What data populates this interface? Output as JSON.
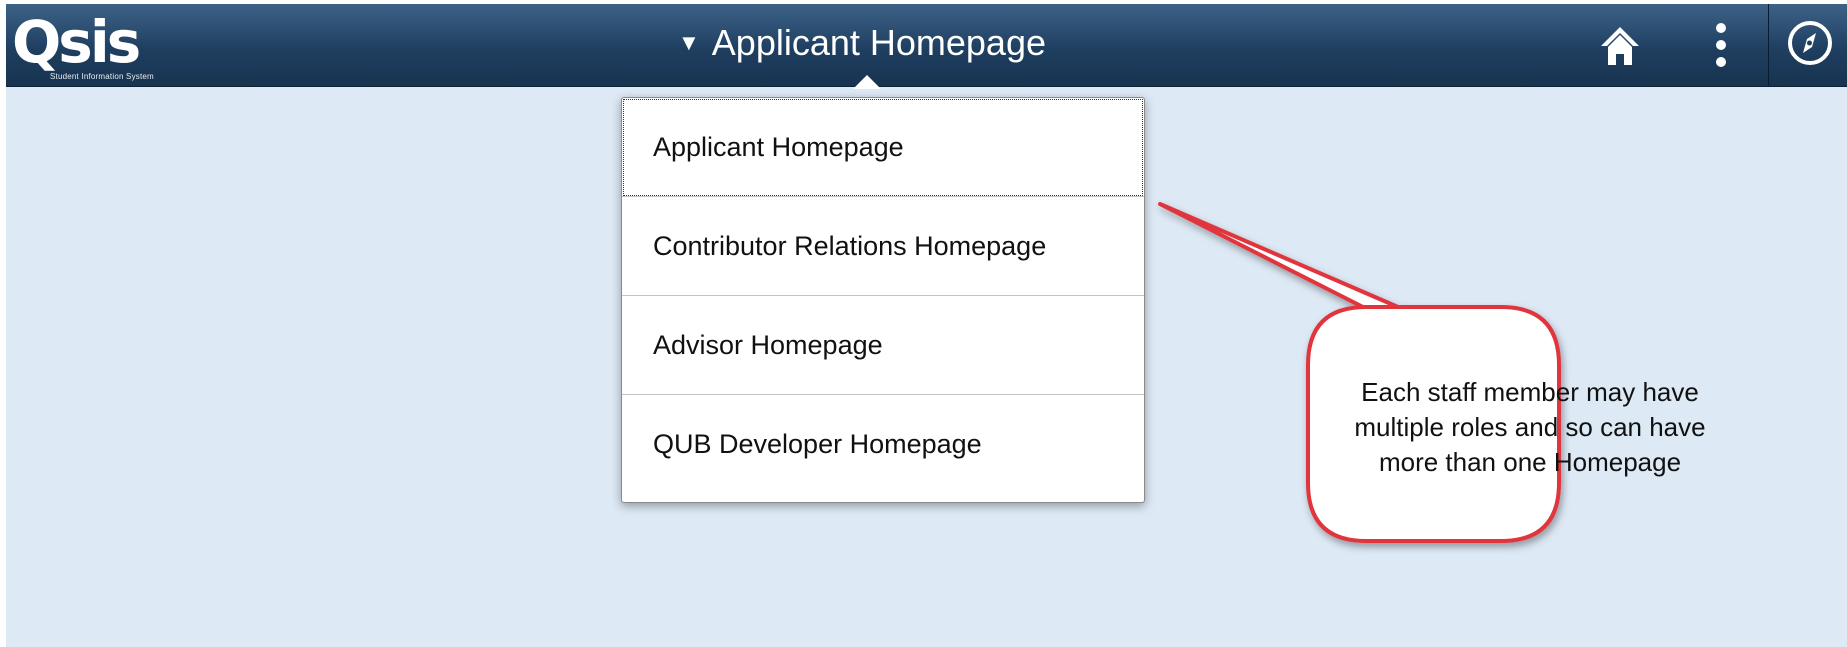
{
  "banner": {
    "logo_text": "Qsis",
    "logo_subtext": "Student Information System",
    "title": "Applicant Homepage",
    "title_arrow": "▼"
  },
  "icons": {
    "home": "home-icon",
    "actions": "actions-list-icon",
    "navbar": "navbar-compass-icon"
  },
  "homepage_menu": {
    "items": [
      {
        "label": "Applicant Homepage",
        "focused": true
      },
      {
        "label": "Contributor Relations Homepage",
        "focused": false
      },
      {
        "label": "Advisor Homepage",
        "focused": false
      },
      {
        "label": "QUB Developer Homepage",
        "focused": false
      }
    ]
  },
  "callout": {
    "text_lines": [
      "Each staff member may have",
      "multiple roles and so can have",
      "more than one Homepage"
    ]
  },
  "colors": {
    "banner": "#1f3f61",
    "background": "#dde9f5",
    "callout_border": "#e0343c"
  }
}
